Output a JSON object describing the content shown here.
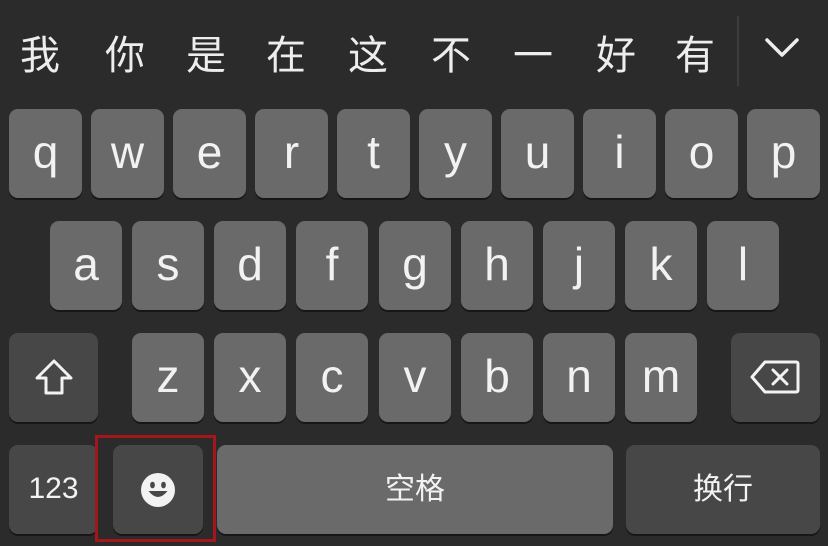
{
  "candidates": [
    "我",
    "你",
    "是",
    "在",
    "这",
    "不",
    "一",
    "好",
    "有"
  ],
  "icons": {
    "collapse": "chevron-down-icon",
    "shift": "shift-arrow-icon",
    "backspace": "backspace-icon",
    "emoji": "smiley-icon"
  },
  "keyboard": {
    "row1": [
      "q",
      "w",
      "e",
      "r",
      "t",
      "y",
      "u",
      "i",
      "o",
      "p"
    ],
    "row2": [
      "a",
      "s",
      "d",
      "f",
      "g",
      "h",
      "j",
      "k",
      "l"
    ],
    "row3": [
      "z",
      "x",
      "c",
      "v",
      "b",
      "n",
      "m"
    ],
    "bottom": {
      "numbers_label": "123",
      "space_label": "空格",
      "return_label": "换行"
    }
  },
  "colors": {
    "background": "#2b2b2b",
    "letter_key": "#6a6a6a",
    "function_key": "#474747",
    "highlight_border": "#a5151c"
  }
}
